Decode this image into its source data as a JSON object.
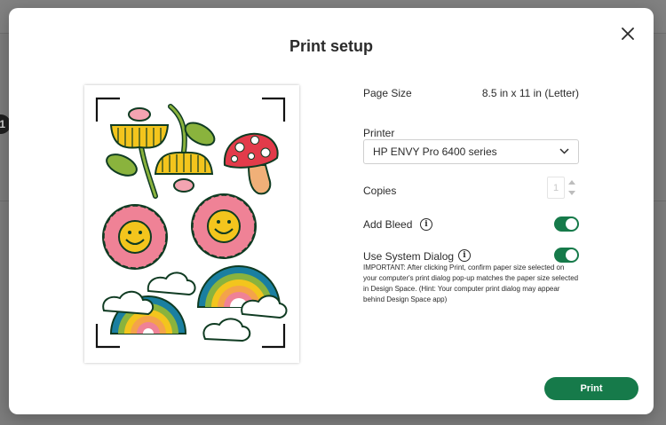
{
  "dialog": {
    "title": "Print setup",
    "page_size_label": "Page Size",
    "page_size_value": "8.5 in x 11 in (Letter)",
    "printer_label": "Printer",
    "printer_value": "HP ENVY Pro 6400 series",
    "copies_label": "Copies",
    "copies_value": "1",
    "add_bleed_label": "Add Bleed",
    "add_bleed_on": true,
    "system_dialog_label": "Use System Dialog",
    "system_dialog_on": true,
    "system_dialog_note": "IMPORTANT: After clicking Print, confirm paper size selected on your computer's print dialog pop-up matches the paper size selected in Design Space. (Hint: Your computer print dialog may appear behind Design Space app)",
    "print_button": "Print"
  },
  "background": {
    "badge": "1"
  },
  "colors": {
    "accent": "#167a4a",
    "overlay": "#7c7c7c",
    "text": "#2b2b2b"
  },
  "icons": {
    "close": "close-icon",
    "info": "info-icon",
    "dropdown": "chevron-down-icon"
  }
}
